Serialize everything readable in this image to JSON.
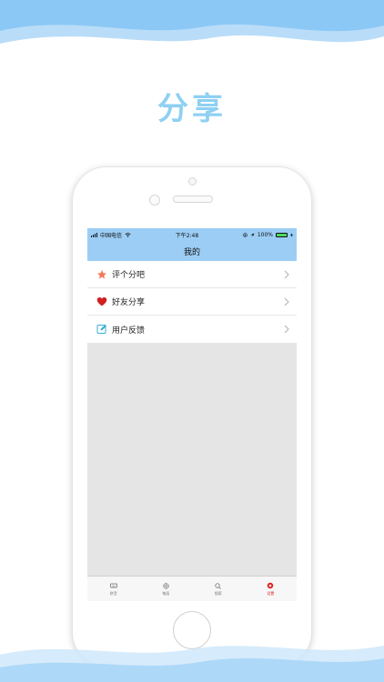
{
  "headline": "分享",
  "status_bar": {
    "carrier": "中国电信",
    "time": "下午2:48",
    "battery": "100%"
  },
  "nav": {
    "title": "我的"
  },
  "menu": [
    {
      "label": "评个分吧",
      "icon": "star-icon"
    },
    {
      "label": "好友分享",
      "icon": "heart-icon"
    },
    {
      "label": "用户反馈",
      "icon": "edit-icon"
    }
  ],
  "tabs": [
    {
      "label": "拼音",
      "icon": "keyboard-icon",
      "active": false
    },
    {
      "label": "笔画",
      "icon": "brush-icon",
      "active": false
    },
    {
      "label": "搜索",
      "icon": "search-icon",
      "active": false
    },
    {
      "label": "设置",
      "icon": "settings-icon",
      "active": true
    }
  ],
  "colors": {
    "accent": "#9ccdf5",
    "headline": "#8fd0f3",
    "active_tab": "#e02020",
    "star": "#f07a5a",
    "heart": "#d02020",
    "edit": "#3aaed8"
  }
}
